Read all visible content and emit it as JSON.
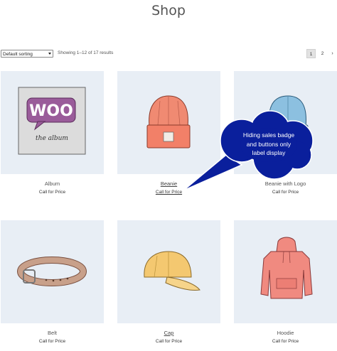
{
  "page": {
    "title": "Shop"
  },
  "toolbar": {
    "sort_value": "Default sorting",
    "result_count": "Showing 1–12 of 17 results",
    "pagination": {
      "page1": "1",
      "page2": "2",
      "next": "›"
    }
  },
  "products": [
    {
      "name": "Album",
      "price": "Call for Price",
      "image": "album-icon"
    },
    {
      "name": "Beanie",
      "price": "Call for Price",
      "image": "beanie-icon"
    },
    {
      "name": "Beanie with Logo",
      "price": "Call for Price",
      "image": "beanie-with-logo-icon"
    },
    {
      "name": "Belt",
      "price": "Call for Price",
      "image": "belt-icon"
    },
    {
      "name": "Cap",
      "price": "Call for Price",
      "image": "cap-icon"
    },
    {
      "name": "Hoodie",
      "price": "Call for Price",
      "image": "hoodie-icon"
    }
  ],
  "album_art": {
    "logo_text": "WOO",
    "caption": "the album"
  },
  "callout": {
    "line1": "Hiding sales badge",
    "line2": "and buttons only",
    "line3": "label display",
    "color": "#0a1f9c"
  },
  "colors": {
    "thumb_bg": "#e8eef5",
    "beanie": "#f08a72",
    "beanie_logo_hat": "#8cc0e0",
    "cap": "#f4c870",
    "hoodie": "#f08a80",
    "belt": "#c8a08a",
    "woo": "#9a5c9a"
  }
}
